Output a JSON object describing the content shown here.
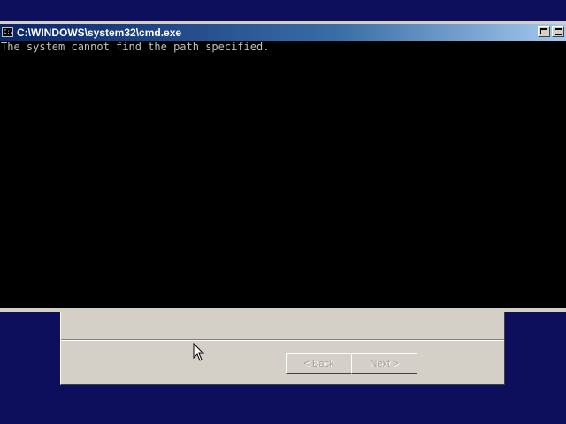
{
  "window": {
    "title": "C:\\WINDOWS\\system32\\cmd.exe",
    "icon_label": "C:\\"
  },
  "console": {
    "lines": [
      "The system cannot find the path specified."
    ]
  },
  "wizard": {
    "back_label": "< Back",
    "next_label": "Next >"
  },
  "colors": {
    "desktop": "#0d0f5c",
    "titlebar_active": "#0a246a",
    "console_bg": "#000000",
    "console_fg": "#c0c0c0",
    "dialog_face": "#d4d0c8"
  }
}
